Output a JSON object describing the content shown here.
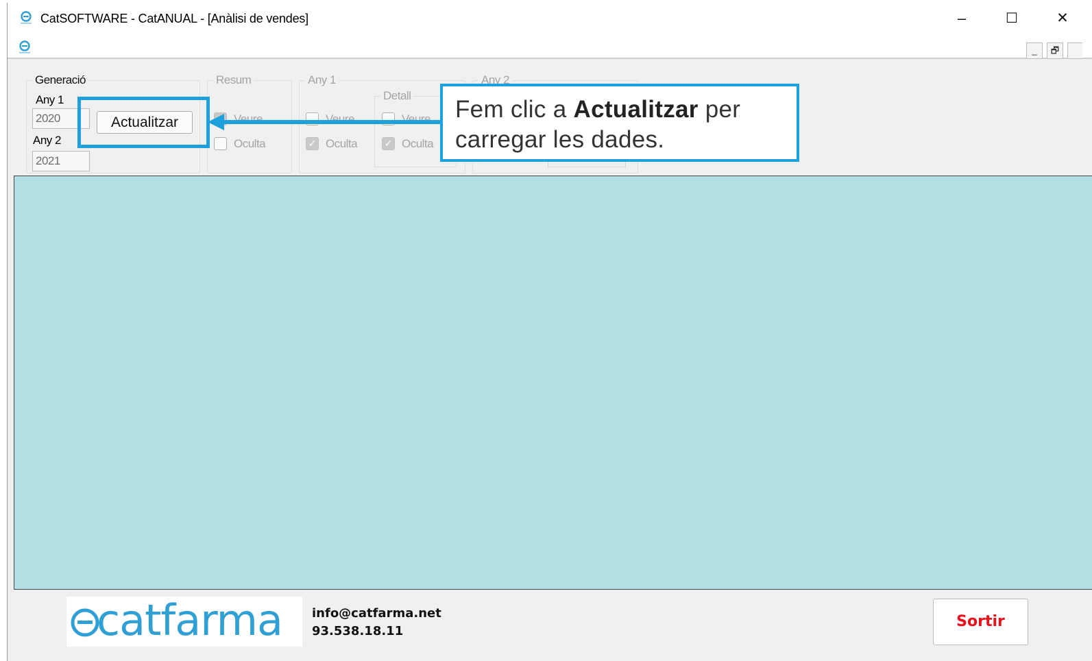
{
  "window": {
    "title": "CatSOFTWARE - CatANUAL - [Anàlisi de vendes]",
    "minimize_icon": "minimize-icon",
    "maximize_icon": "maximize-icon",
    "close_icon": "close-icon",
    "minimize_glyph": "–",
    "maximize_glyph": "☐",
    "close_glyph": "✕"
  },
  "mdi": {
    "minimize_glyph": "_",
    "restore_glyph": "🗗"
  },
  "generacio": {
    "legend": "Generació",
    "any1_label": "Any 1",
    "any1_value": "2020",
    "any2_label": "Any 2",
    "any2_value": "2021",
    "refresh_button": "Actualitzar"
  },
  "resum": {
    "legend": "Resum",
    "veure_label": "Veure",
    "veure_checked": true,
    "oculta_label": "Oculta",
    "oculta_checked": false
  },
  "any1_group": {
    "legend": "Any 1",
    "veure_label": "Veure",
    "veure_checked": false,
    "oculta_label": "Oculta",
    "oculta_checked": true,
    "detall": {
      "legend": "Detall",
      "veure_label": "Veure",
      "veure_checked": false,
      "oculta_label": "Oculta",
      "oculta_checked": true
    }
  },
  "any2_group": {
    "legend": "Any 2"
  },
  "callout": {
    "text_before": "Fem clic a ",
    "text_bold": "Actualitzar",
    "text_after_line1": " per",
    "text_line2": "carregar les dades.",
    "color": "#1ea0dc"
  },
  "data_area": {
    "background": "#b1dfe4"
  },
  "footer": {
    "logo_text_cat": "cat",
    "logo_text_farma": "farma",
    "email": "info@catfarma.net",
    "phone": "93.538.18.11",
    "exit_button": "Sortir",
    "exit_color": "#e8101a"
  }
}
